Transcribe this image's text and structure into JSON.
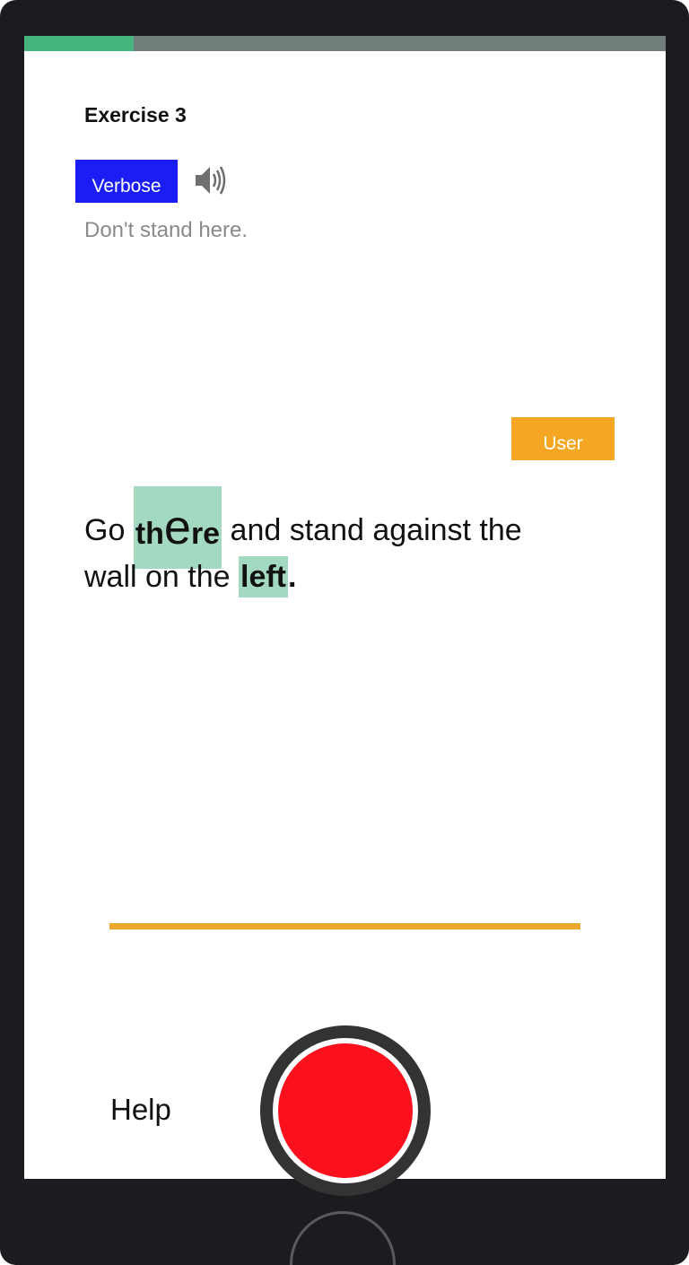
{
  "header": {
    "title": "Exercise 3",
    "progress": 0.17
  },
  "prompt": {
    "verbose_label": "Verbose",
    "speaker_icon": "speaker-icon",
    "hint": "Don't stand here."
  },
  "user_label": "User",
  "sentence": {
    "go": "Go",
    "there_th": "th",
    "there_e": "e",
    "there_re": "re",
    "mid": "and stand against the",
    "line2_start": "wall on the",
    "left": "left",
    "end": "."
  },
  "footer": {
    "help_label": "Help"
  },
  "colors": {
    "progress_fill": "#44b57f",
    "verbose": "#1a1ef5",
    "user": "#f5a623",
    "highlight": "#a3d9c1",
    "record": "#fb101e"
  }
}
